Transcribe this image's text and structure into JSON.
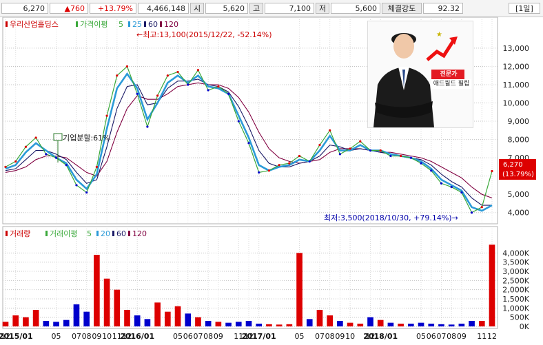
{
  "header": {
    "price": "6,270",
    "change": "▲760",
    "change_pct": "+13.79%",
    "volume": "4,466,148",
    "open_label": "시",
    "open": "5,620",
    "high_label": "고",
    "high": "7,100",
    "low_label": "저",
    "low": "5,600",
    "strength_label": "체결강도",
    "strength": "92.32",
    "period": "[1일]"
  },
  "legend": {
    "stock_name": "우리산업홀딩스",
    "ma_label": "가격이평",
    "ma_periods": [
      "5",
      "25",
      "60",
      "120"
    ],
    "volume_label": "거래량",
    "vma_label": "거래이평",
    "vma_periods": [
      "5",
      "20",
      "60",
      "120"
    ]
  },
  "annotations": {
    "high": "←최고:13,100(2015/12/22, -52.14%)",
    "low": "최저:3,500(2018/10/30, +79.14%)→",
    "split": "기업분할:61%",
    "current_price": "6,270",
    "current_pct": "(13.79%)"
  },
  "ad": {
    "tag": "전문가",
    "name": "애드윌드 필립"
  },
  "colors": {
    "up": "#dd0000",
    "down": "#0000cc",
    "ma5": "#3aa83a",
    "ma25": "#2b9ad8",
    "ma60": "#1a1a66",
    "ma120": "#800040"
  },
  "chart_data": [
    {
      "type": "line",
      "title": "우리산업홀딩스",
      "subtitle": "일봉 가격",
      "x": [
        "2014-12",
        "2015-01",
        "2015-02",
        "2015-03",
        "2015-04",
        "2015-05",
        "2015-06",
        "2015-07",
        "2015-08",
        "2015-09",
        "2015-10",
        "2015-11",
        "2015-12",
        "2016-01",
        "2016-02",
        "2016-03",
        "2016-04",
        "2016-05",
        "2016-06",
        "2016-07",
        "2016-08",
        "2016-09",
        "2016-10",
        "2016-11",
        "2016-12",
        "2017-01",
        "2017-02",
        "2017-03",
        "2017-04",
        "2017-05",
        "2017-06",
        "2017-07",
        "2017-08",
        "2017-09",
        "2017-10",
        "2017-11",
        "2017-12",
        "2018-01",
        "2018-02",
        "2018-03",
        "2018-04",
        "2018-05",
        "2018-06",
        "2018-07",
        "2018-08",
        "2018-09",
        "2018-10",
        "2018-11",
        "2018-12"
      ],
      "series": [
        {
          "name": "5",
          "values": [
            6500,
            6800,
            7600,
            8100,
            7200,
            7000,
            6600,
            5500,
            5100,
            6500,
            9300,
            11500,
            12000,
            10500,
            8700,
            10400,
            11500,
            11700,
            11000,
            11800,
            10700,
            10900,
            10500,
            9000,
            7800,
            6200,
            6300,
            6600,
            6700,
            7100,
            6800,
            7700,
            8500,
            7200,
            7500,
            7900,
            7400,
            7400,
            7100,
            7100,
            7000,
            6700,
            6300,
            5600,
            5400,
            5100,
            4000,
            4300,
            6270
          ]
        },
        {
          "name": "25",
          "values": [
            6400,
            6600,
            7300,
            7800,
            7400,
            7000,
            6700,
            5800,
            5300,
            6100,
            8600,
            10800,
            11600,
            10800,
            9100,
            10000,
            11100,
            11500,
            11100,
            11500,
            10900,
            10800,
            10500,
            9300,
            8100,
            6600,
            6300,
            6500,
            6600,
            6900,
            6800,
            7400,
            8200,
            7400,
            7400,
            7700,
            7400,
            7400,
            7200,
            7100,
            7000,
            6800,
            6400,
            5800,
            5500,
            5200,
            4300,
            4100,
            4400
          ]
        },
        {
          "name": "60",
          "values": [
            6300,
            6400,
            6900,
            7400,
            7400,
            7200,
            6900,
            6200,
            5600,
            5800,
            7600,
            9700,
            10900,
            11000,
            9900,
            10000,
            10800,
            11200,
            11200,
            11300,
            11000,
            10900,
            10600,
            9800,
            8700,
            7400,
            6700,
            6500,
            6500,
            6700,
            6800,
            7100,
            7700,
            7600,
            7400,
            7500,
            7400,
            7300,
            7200,
            7100,
            7000,
            6900,
            6600,
            6100,
            5700,
            5400,
            4800,
            4400,
            4400
          ]
        },
        {
          "name": "120",
          "values": [
            6200,
            6300,
            6500,
            6900,
            7100,
            7100,
            7000,
            6600,
            6200,
            6000,
            6800,
            8400,
            9700,
            10400,
            10200,
            10200,
            10500,
            10900,
            11000,
            11100,
            11000,
            11000,
            10800,
            10300,
            9500,
            8400,
            7500,
            7000,
            6800,
            6700,
            6800,
            6900,
            7300,
            7500,
            7500,
            7500,
            7400,
            7300,
            7300,
            7200,
            7100,
            7000,
            6800,
            6500,
            6200,
            5900,
            5400,
            5000,
            4800
          ]
        }
      ],
      "ylim": [
        3500,
        13600
      ],
      "y_ticks": [
        "4,000",
        "5,000",
        "6,000",
        "7,000",
        "8,000",
        "9,000",
        "10,000",
        "11,000",
        "12,000",
        "13,000"
      ],
      "y_tick_values": [
        4000,
        5000,
        6000,
        7000,
        8000,
        9000,
        10000,
        11000,
        12000,
        13000
      ],
      "x_tick_labels": [
        "12",
        "2015/01",
        "05",
        "07",
        "08",
        "09",
        "10",
        "11",
        "12",
        "2016/01",
        "05",
        "06",
        "07",
        "08",
        "09",
        "11",
        "12",
        "2017/01",
        "05",
        "07",
        "08",
        "09",
        "10",
        "12",
        "2018/01",
        "05",
        "06",
        "07",
        "08",
        "09",
        "11",
        "12"
      ],
      "x_tick_months": [
        "2014-12",
        "2015-01",
        "2015-05",
        "2015-07",
        "2015-08",
        "2015-09",
        "2015-10",
        "2015-11",
        "2015-12",
        "2016-01",
        "2016-05",
        "2016-06",
        "2016-07",
        "2016-08",
        "2016-09",
        "2016-11",
        "2016-12",
        "2017-01",
        "2017-05",
        "2017-07",
        "2017-08",
        "2017-09",
        "2017-10",
        "2017-12",
        "2018-01",
        "2018-05",
        "2018-06",
        "2018-07",
        "2018-08",
        "2018-09",
        "2018-11",
        "2018-12"
      ],
      "grid": true
    },
    {
      "type": "bar",
      "title": "거래량",
      "x": [
        "2014-12",
        "2015-01",
        "2015-02",
        "2015-03",
        "2015-04",
        "2015-05",
        "2015-06",
        "2015-07",
        "2015-08",
        "2015-09",
        "2015-10",
        "2015-11",
        "2015-12",
        "2016-01",
        "2016-02",
        "2016-03",
        "2016-04",
        "2016-05",
        "2016-06",
        "2016-07",
        "2016-08",
        "2016-09",
        "2016-10",
        "2016-11",
        "2016-12",
        "2017-01",
        "2017-02",
        "2017-03",
        "2017-04",
        "2017-05",
        "2017-06",
        "2017-07",
        "2017-08",
        "2017-09",
        "2017-10",
        "2017-11",
        "2017-12",
        "2018-01",
        "2018-02",
        "2018-03",
        "2018-04",
        "2018-05",
        "2018-06",
        "2018-07",
        "2018-08",
        "2018-09",
        "2018-10",
        "2018-11",
        "2018-12"
      ],
      "values": [
        250000,
        600000,
        500000,
        900000,
        300000,
        250000,
        350000,
        1200000,
        800000,
        3900000,
        2600000,
        2000000,
        900000,
        600000,
        400000,
        1300000,
        800000,
        1100000,
        700000,
        500000,
        300000,
        250000,
        200000,
        250000,
        300000,
        150000,
        120000,
        100000,
        120000,
        4000000,
        400000,
        900000,
        600000,
        300000,
        200000,
        150000,
        500000,
        350000,
        200000,
        150000,
        150000,
        200000,
        150000,
        120000,
        100000,
        150000,
        300000,
        300000,
        4450000
      ],
      "ylim": [
        0,
        4650000
      ],
      "y_ticks": [
        "0K",
        "500K",
        "1,000K",
        "1,500K",
        "2,000K",
        "2,500K",
        "3,000K",
        "3,500K",
        "4,000K"
      ],
      "y_tick_values": [
        0,
        500000,
        1000000,
        1500000,
        2000000,
        2500000,
        3000000,
        3500000,
        4000000
      ],
      "grid": true
    }
  ]
}
